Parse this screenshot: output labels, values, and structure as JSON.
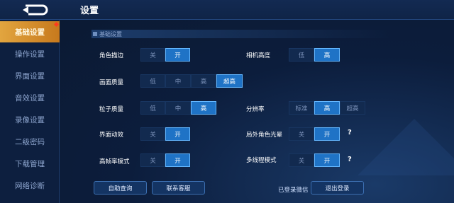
{
  "header": {
    "title": "设置",
    "back": "back-icon"
  },
  "sidebar": {
    "items": [
      {
        "label": "基础设置",
        "active": true
      },
      {
        "label": "操作设置"
      },
      {
        "label": "界面设置"
      },
      {
        "label": "音效设置"
      },
      {
        "label": "录像设置"
      },
      {
        "label": "二级密码"
      },
      {
        "label": "下载管理"
      },
      {
        "label": "网络诊断"
      }
    ]
  },
  "section": {
    "title": "基础设置"
  },
  "settings": {
    "outline": {
      "label": "角色描边",
      "options": [
        "关",
        "开"
      ],
      "selected": "开"
    },
    "camera_height": {
      "label": "相机高度",
      "options": [
        "低",
        "高"
      ],
      "selected": "高"
    },
    "graphics_quality": {
      "label": "画面质量",
      "options": [
        "低",
        "中",
        "高",
        "超高"
      ],
      "selected": "超高"
    },
    "particle_quality": {
      "label": "粒子质量",
      "options": [
        "低",
        "中",
        "高"
      ],
      "selected": "高"
    },
    "resolution": {
      "label": "分辨率",
      "options": [
        "标准",
        "高",
        "超高"
      ],
      "selected": "高"
    },
    "ui_animation": {
      "label": "界面动效",
      "options": [
        "关",
        "开"
      ],
      "selected": "开"
    },
    "outfield_halo": {
      "label": "局外角色光晕",
      "options": [
        "关",
        "开"
      ],
      "selected": "开",
      "help": "?"
    },
    "high_fps": {
      "label": "高帧率模式",
      "options": [
        "关",
        "开"
      ],
      "selected": "开"
    },
    "multithread": {
      "label": "多线程模式",
      "options": [
        "关",
        "开"
      ],
      "selected": "开",
      "help": "?"
    }
  },
  "footer": {
    "self_help": "自助查询",
    "contact": "联系客服",
    "logged_in": "已登录微信",
    "logout": "退出登录"
  },
  "colors": {
    "accent": "#1f73c6",
    "active_tab": "#e2a53f",
    "bg": "#0b1a33"
  }
}
